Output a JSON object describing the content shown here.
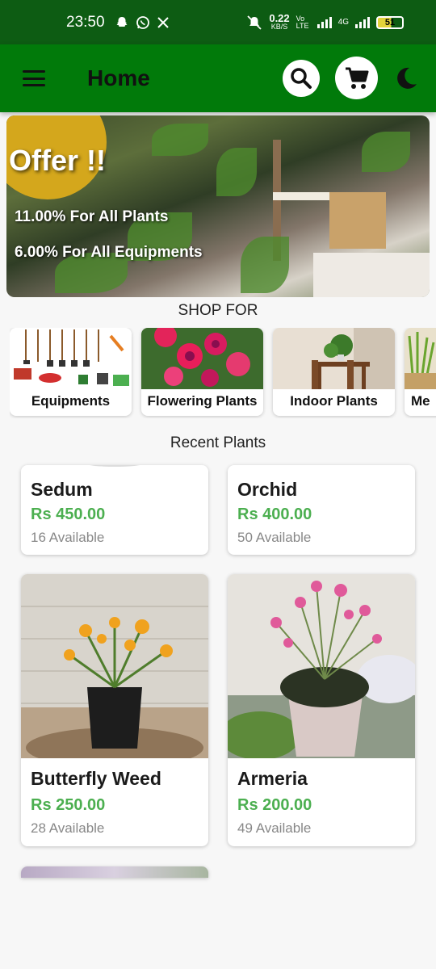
{
  "status_bar": {
    "time": "23:50",
    "net_speed": "0.22",
    "net_unit": "KB/S",
    "volte": "Vo LTE",
    "network": "4G",
    "battery": "51",
    "notification_icons": [
      "snapchat-icon",
      "whatsapp-icon",
      "x-icon"
    ]
  },
  "app_bar": {
    "title": "Home",
    "icons": [
      "menu-icon",
      "search-icon",
      "cart-icon",
      "moon-icon"
    ]
  },
  "banner": {
    "offer_title": "Offer !!",
    "offer_lines": [
      "11.00% For All Plants",
      "6.00% For All Equipments"
    ],
    "accent_color": "#d4a71c"
  },
  "shop_for": {
    "heading": "SHOP FOR",
    "categories": [
      {
        "label": "Equipments"
      },
      {
        "label": "Flowering Plants"
      },
      {
        "label": "Indoor Plants"
      },
      {
        "label": "Me"
      }
    ]
  },
  "recent": {
    "heading": "Recent Plants",
    "plants": [
      {
        "name": "Sedum",
        "price": "Rs 450.00",
        "available": "16 Available"
      },
      {
        "name": "Orchid",
        "price": "Rs 400.00",
        "available": "50 Available"
      },
      {
        "name": "Butterfly Weed",
        "price": "Rs 250.00",
        "available": "28 Available"
      },
      {
        "name": "Armeria",
        "price": "Rs 200.00",
        "available": "49 Available"
      }
    ]
  },
  "colors": {
    "status_bar": "#0d5c13",
    "app_bar": "#017a0a",
    "price_green": "#4caf50"
  }
}
